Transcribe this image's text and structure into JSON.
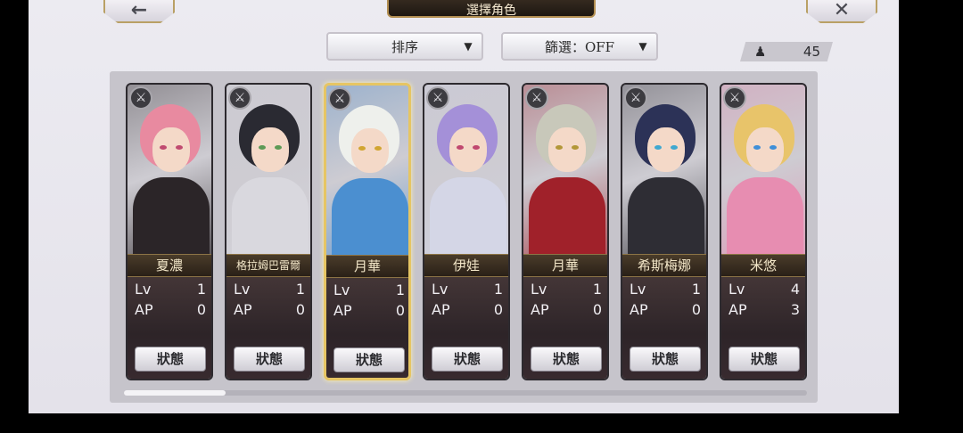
{
  "header": {
    "title": "選擇角色"
  },
  "controls": {
    "sort_label": "排序",
    "filter_label": "篩選：OFF",
    "count": "45"
  },
  "characters": [
    {
      "name": "夏濃",
      "lv_label": "Lv",
      "lv": "1",
      "ap_label": "AP",
      "ap": "0",
      "status": "狀態",
      "hair": "#e88aa0",
      "body": "#2b2528",
      "eye": "#c04a70"
    },
    {
      "name": "格拉姆巴雷爾",
      "lv_label": "Lv",
      "lv": "1",
      "ap_label": "AP",
      "ap": "0",
      "status": "狀態",
      "hair": "#2a2a32",
      "body": "#d9d8de",
      "eye": "#5c9a55"
    },
    {
      "name": "月華",
      "lv_label": "Lv",
      "lv": "1",
      "ap_label": "AP",
      "ap": "0",
      "status": "狀態",
      "hair": "#eef0ec",
      "body": "#4b8fd0",
      "eye": "#d1a531"
    },
    {
      "name": "伊娃",
      "lv_label": "Lv",
      "lv": "1",
      "ap_label": "AP",
      "ap": "0",
      "status": "狀態",
      "hair": "#a490d8",
      "body": "#d4d6e6",
      "eye": "#c0476f"
    },
    {
      "name": "月華",
      "lv_label": "Lv",
      "lv": "1",
      "ap_label": "AP",
      "ap": "0",
      "status": "狀態",
      "hair": "#c8c8ba",
      "body": "#a0212a",
      "eye": "#b29738"
    },
    {
      "name": "希斯梅娜",
      "lv_label": "Lv",
      "lv": "1",
      "ap_label": "AP",
      "ap": "0",
      "status": "狀態",
      "hair": "#2c3257",
      "body": "#2e2d34",
      "eye": "#3fa8d0"
    },
    {
      "name": "米悠",
      "lv_label": "Lv",
      "lv": "4",
      "ap_label": "AP",
      "ap": "3",
      "status": "狀態",
      "hair": "#e8c46a",
      "body": "#e78db1",
      "eye": "#3f8fd8"
    }
  ],
  "colors": {
    "accent_gold": "#e6c563",
    "panel": "#c6c4cb"
  }
}
